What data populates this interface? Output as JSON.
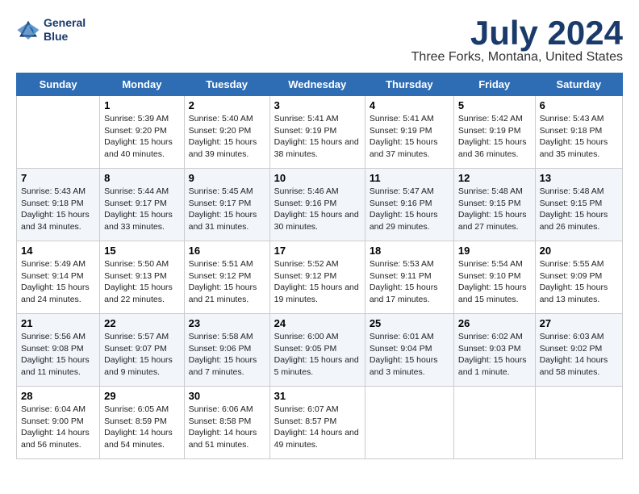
{
  "header": {
    "logo_line1": "General",
    "logo_line2": "Blue",
    "title": "July 2024",
    "subtitle": "Three Forks, Montana, United States"
  },
  "days_of_week": [
    "Sunday",
    "Monday",
    "Tuesday",
    "Wednesday",
    "Thursday",
    "Friday",
    "Saturday"
  ],
  "weeks": [
    [
      {
        "date": "",
        "sunrise": "",
        "sunset": "",
        "daylight": ""
      },
      {
        "date": "1",
        "sunrise": "Sunrise: 5:39 AM",
        "sunset": "Sunset: 9:20 PM",
        "daylight": "Daylight: 15 hours and 40 minutes."
      },
      {
        "date": "2",
        "sunrise": "Sunrise: 5:40 AM",
        "sunset": "Sunset: 9:20 PM",
        "daylight": "Daylight: 15 hours and 39 minutes."
      },
      {
        "date": "3",
        "sunrise": "Sunrise: 5:41 AM",
        "sunset": "Sunset: 9:19 PM",
        "daylight": "Daylight: 15 hours and 38 minutes."
      },
      {
        "date": "4",
        "sunrise": "Sunrise: 5:41 AM",
        "sunset": "Sunset: 9:19 PM",
        "daylight": "Daylight: 15 hours and 37 minutes."
      },
      {
        "date": "5",
        "sunrise": "Sunrise: 5:42 AM",
        "sunset": "Sunset: 9:19 PM",
        "daylight": "Daylight: 15 hours and 36 minutes."
      },
      {
        "date": "6",
        "sunrise": "Sunrise: 5:43 AM",
        "sunset": "Sunset: 9:18 PM",
        "daylight": "Daylight: 15 hours and 35 minutes."
      }
    ],
    [
      {
        "date": "7",
        "sunrise": "Sunrise: 5:43 AM",
        "sunset": "Sunset: 9:18 PM",
        "daylight": "Daylight: 15 hours and 34 minutes."
      },
      {
        "date": "8",
        "sunrise": "Sunrise: 5:44 AM",
        "sunset": "Sunset: 9:17 PM",
        "daylight": "Daylight: 15 hours and 33 minutes."
      },
      {
        "date": "9",
        "sunrise": "Sunrise: 5:45 AM",
        "sunset": "Sunset: 9:17 PM",
        "daylight": "Daylight: 15 hours and 31 minutes."
      },
      {
        "date": "10",
        "sunrise": "Sunrise: 5:46 AM",
        "sunset": "Sunset: 9:16 PM",
        "daylight": "Daylight: 15 hours and 30 minutes."
      },
      {
        "date": "11",
        "sunrise": "Sunrise: 5:47 AM",
        "sunset": "Sunset: 9:16 PM",
        "daylight": "Daylight: 15 hours and 29 minutes."
      },
      {
        "date": "12",
        "sunrise": "Sunrise: 5:48 AM",
        "sunset": "Sunset: 9:15 PM",
        "daylight": "Daylight: 15 hours and 27 minutes."
      },
      {
        "date": "13",
        "sunrise": "Sunrise: 5:48 AM",
        "sunset": "Sunset: 9:15 PM",
        "daylight": "Daylight: 15 hours and 26 minutes."
      }
    ],
    [
      {
        "date": "14",
        "sunrise": "Sunrise: 5:49 AM",
        "sunset": "Sunset: 9:14 PM",
        "daylight": "Daylight: 15 hours and 24 minutes."
      },
      {
        "date": "15",
        "sunrise": "Sunrise: 5:50 AM",
        "sunset": "Sunset: 9:13 PM",
        "daylight": "Daylight: 15 hours and 22 minutes."
      },
      {
        "date": "16",
        "sunrise": "Sunrise: 5:51 AM",
        "sunset": "Sunset: 9:12 PM",
        "daylight": "Daylight: 15 hours and 21 minutes."
      },
      {
        "date": "17",
        "sunrise": "Sunrise: 5:52 AM",
        "sunset": "Sunset: 9:12 PM",
        "daylight": "Daylight: 15 hours and 19 minutes."
      },
      {
        "date": "18",
        "sunrise": "Sunrise: 5:53 AM",
        "sunset": "Sunset: 9:11 PM",
        "daylight": "Daylight: 15 hours and 17 minutes."
      },
      {
        "date": "19",
        "sunrise": "Sunrise: 5:54 AM",
        "sunset": "Sunset: 9:10 PM",
        "daylight": "Daylight: 15 hours and 15 minutes."
      },
      {
        "date": "20",
        "sunrise": "Sunrise: 5:55 AM",
        "sunset": "Sunset: 9:09 PM",
        "daylight": "Daylight: 15 hours and 13 minutes."
      }
    ],
    [
      {
        "date": "21",
        "sunrise": "Sunrise: 5:56 AM",
        "sunset": "Sunset: 9:08 PM",
        "daylight": "Daylight: 15 hours and 11 minutes."
      },
      {
        "date": "22",
        "sunrise": "Sunrise: 5:57 AM",
        "sunset": "Sunset: 9:07 PM",
        "daylight": "Daylight: 15 hours and 9 minutes."
      },
      {
        "date": "23",
        "sunrise": "Sunrise: 5:58 AM",
        "sunset": "Sunset: 9:06 PM",
        "daylight": "Daylight: 15 hours and 7 minutes."
      },
      {
        "date": "24",
        "sunrise": "Sunrise: 6:00 AM",
        "sunset": "Sunset: 9:05 PM",
        "daylight": "Daylight: 15 hours and 5 minutes."
      },
      {
        "date": "25",
        "sunrise": "Sunrise: 6:01 AM",
        "sunset": "Sunset: 9:04 PM",
        "daylight": "Daylight: 15 hours and 3 minutes."
      },
      {
        "date": "26",
        "sunrise": "Sunrise: 6:02 AM",
        "sunset": "Sunset: 9:03 PM",
        "daylight": "Daylight: 15 hours and 1 minute."
      },
      {
        "date": "27",
        "sunrise": "Sunrise: 6:03 AM",
        "sunset": "Sunset: 9:02 PM",
        "daylight": "Daylight: 14 hours and 58 minutes."
      }
    ],
    [
      {
        "date": "28",
        "sunrise": "Sunrise: 6:04 AM",
        "sunset": "Sunset: 9:00 PM",
        "daylight": "Daylight: 14 hours and 56 minutes."
      },
      {
        "date": "29",
        "sunrise": "Sunrise: 6:05 AM",
        "sunset": "Sunset: 8:59 PM",
        "daylight": "Daylight: 14 hours and 54 minutes."
      },
      {
        "date": "30",
        "sunrise": "Sunrise: 6:06 AM",
        "sunset": "Sunset: 8:58 PM",
        "daylight": "Daylight: 14 hours and 51 minutes."
      },
      {
        "date": "31",
        "sunrise": "Sunrise: 6:07 AM",
        "sunset": "Sunset: 8:57 PM",
        "daylight": "Daylight: 14 hours and 49 minutes."
      },
      {
        "date": "",
        "sunrise": "",
        "sunset": "",
        "daylight": ""
      },
      {
        "date": "",
        "sunrise": "",
        "sunset": "",
        "daylight": ""
      },
      {
        "date": "",
        "sunrise": "",
        "sunset": "",
        "daylight": ""
      }
    ]
  ]
}
